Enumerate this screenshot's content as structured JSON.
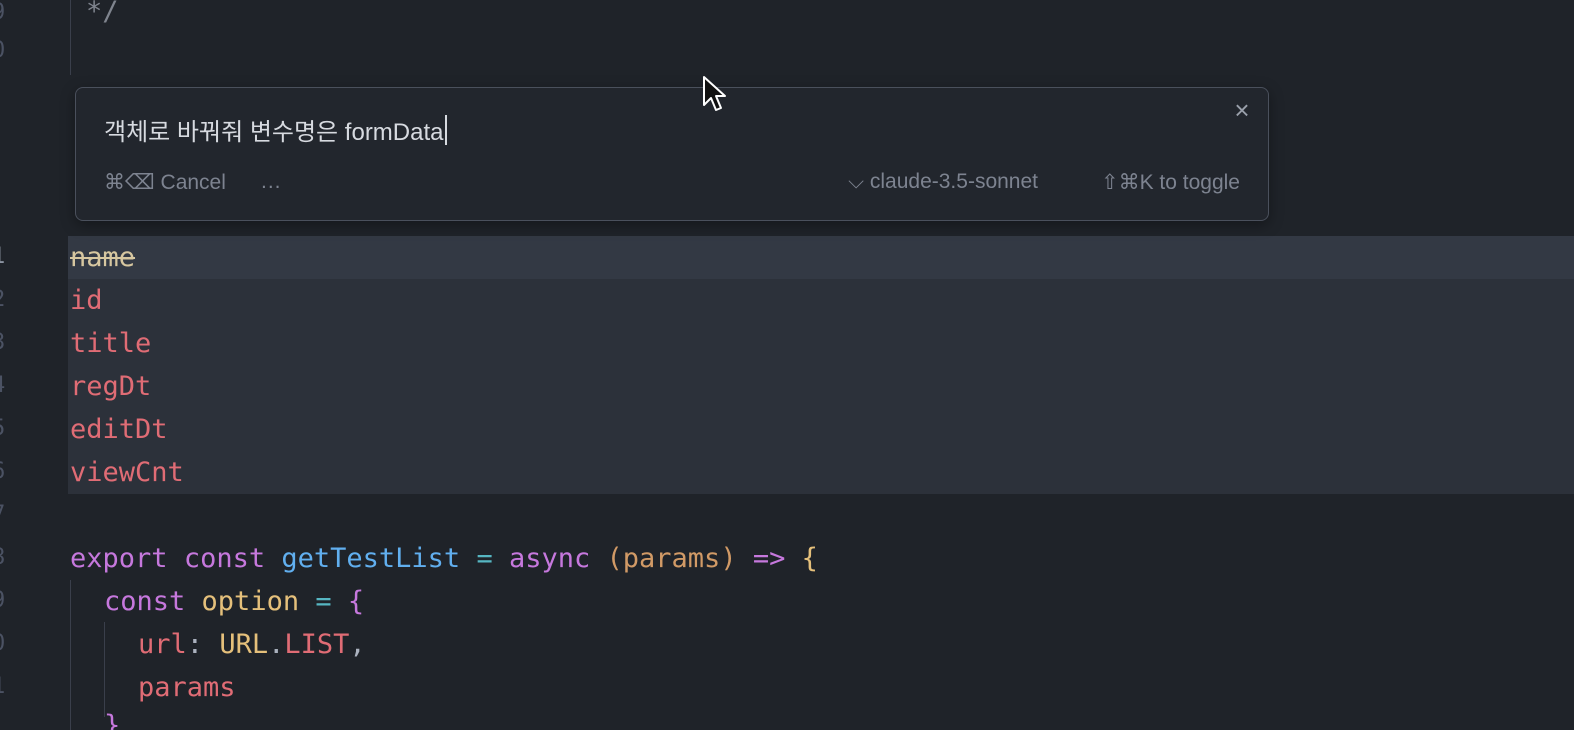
{
  "editor": {
    "gutter": [
      "9",
      "0",
      "1",
      "2",
      "3",
      "4",
      "5",
      "6",
      "7",
      "8",
      "9",
      "0",
      "1"
    ],
    "comment_close": "*/",
    "removed_lines": [
      "name",
      "id",
      "title",
      "regDt",
      "editDt",
      "viewCnt"
    ],
    "code": {
      "l1_export": "export",
      "l1_const": "const",
      "l1_fn": "getTestList",
      "l1_eq": "=",
      "l1_async": "async",
      "l1_open_paren": "(",
      "l1_param": "params",
      "l1_close_paren": ")",
      "l1_arrow": "=>",
      "l1_brace": "{",
      "l2_const": "const",
      "l2_var": "option",
      "l2_eq": "=",
      "l2_brace": "{",
      "l3_key": "url",
      "l3_colon": ":",
      "l3_obj": "URL",
      "l3_dot": ".",
      "l3_prop": "LIST",
      "l3_comma": ",",
      "l4_key": "params",
      "l5_brace": "}"
    }
  },
  "prompt": {
    "input_value": "객체로 바꿔줘 변수명은 formData",
    "close_label": "×",
    "cancel_label": "⌘⌫ Cancel",
    "more_label": "...",
    "model_label": "⌵ claude-3.5-sonnet",
    "toggle_label": "⇧⌘K to toggle"
  },
  "colors": {
    "background": "#1f2329",
    "keyword": "#c678dd",
    "function": "#61afef",
    "variable": "#e5c07b",
    "property": "#e06c75",
    "parameter": "#d19a66"
  },
  "icons": [
    "close-icon",
    "mouse-cursor-icon"
  ]
}
